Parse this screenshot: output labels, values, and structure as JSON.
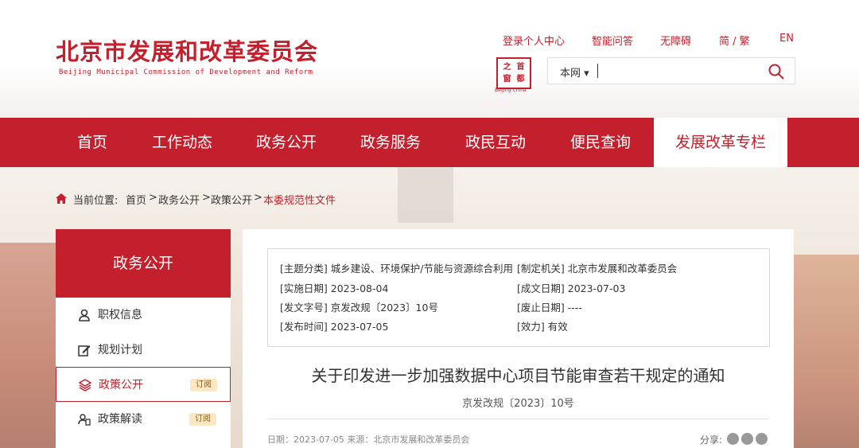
{
  "header": {
    "logo_cn": "北京市发展和改革委员会",
    "logo_en": "Beijing Municipal Commission of Development and Reform",
    "top_links": [
      "登录个人中心",
      "智能问答",
      "无障碍",
      "简 / 繁",
      "EN"
    ],
    "seal_chars": [
      "之",
      "首",
      "窗",
      "都"
    ],
    "seal_caption": "Beijing-China",
    "search": {
      "scope": "本网 ▾",
      "value": "",
      "placeholder": ""
    }
  },
  "nav": {
    "items": [
      "首页",
      "工作动态",
      "政务公开",
      "政务服务",
      "政民互动",
      "便民查询",
      "发展改革专栏"
    ],
    "active_index": 6
  },
  "breadcrumb": {
    "prefix": "当前位置:",
    "items": [
      "首页",
      "政务公开",
      "政策公开",
      "本委规范性文件"
    ],
    "separator": ">"
  },
  "sidebar": {
    "title": "政务公开",
    "items": [
      {
        "label": "职权信息",
        "icon": "person-icon"
      },
      {
        "label": "规划计划",
        "icon": "edit-icon"
      },
      {
        "label": "政策公开",
        "icon": "layers-icon",
        "tag": "订阅",
        "active": true
      },
      {
        "label": "政策解读",
        "icon": "interpret-icon",
        "tag": "订阅"
      }
    ]
  },
  "doc": {
    "meta": {
      "topic_label": "[主题分类]",
      "topic": "城乡建设、环境保护/节能与资源综合利用",
      "issuer_label": "[制定机关]",
      "issuer": "北京市发展和改革委员会",
      "impl_label": "[实施日期]",
      "impl": "2023-08-04",
      "written_label": "[成文日期]",
      "written": "2023-07-03",
      "docno_label": "[发文字号]",
      "docno": "京发改规〔2023〕10号",
      "abolish_label": "[废止日期]",
      "abolish": "----",
      "publish_label": "[发布时间]",
      "publish": "2023-07-05",
      "validity_label": "[效力]",
      "validity": "有效"
    },
    "title": "关于印发进一步加强数据中心项目节能审查若干规定的通知",
    "docno_line": "京发改规〔2023〕10号",
    "dateline": "日期：2023-07-05    来源：北京市发展和改革委员会",
    "share_label": "分享:"
  },
  "colors": {
    "brand_red": "#c41f2c",
    "tag_bg": "#fbe7c2"
  }
}
